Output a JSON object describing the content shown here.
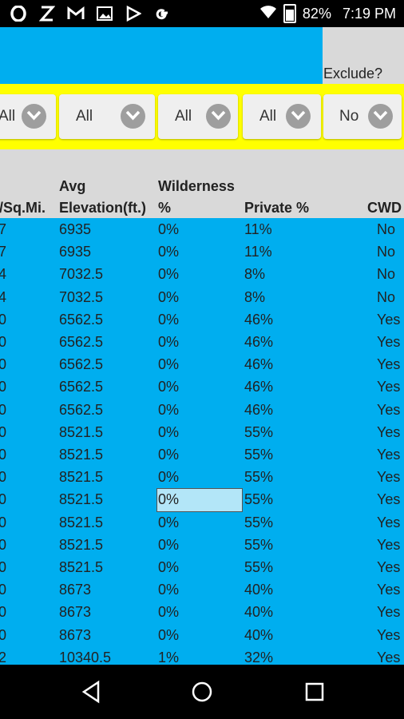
{
  "status_bar": {
    "left_icons": [
      "opera-icon",
      "x-icon",
      "gmail-icon",
      "image-icon",
      "play-store-icon",
      "google-icon"
    ],
    "battery": "82%",
    "time": "7:19 PM"
  },
  "exclude_label": "Exclude?",
  "filters": [
    {
      "label": "All"
    },
    {
      "label": "All"
    },
    {
      "label": "All"
    },
    {
      "label": "All"
    },
    {
      "label": "No"
    }
  ],
  "headers": {
    "col1": "./Sq.Mi.",
    "col2_top": "Avg",
    "col2": "Elevation(ft.)",
    "col3_top": "Wilderness",
    "col3": "%",
    "col4": "Private %",
    "col5": "CWD"
  },
  "rows": [
    {
      "a": "7",
      "b": "6935",
      "c": "0%",
      "d": "11%",
      "e": "No"
    },
    {
      "a": "7",
      "b": "6935",
      "c": "0%",
      "d": "11%",
      "e": "No"
    },
    {
      "a": "4",
      "b": "7032.5",
      "c": "0%",
      "d": "8%",
      "e": "No"
    },
    {
      "a": "4",
      "b": "7032.5",
      "c": "0%",
      "d": "8%",
      "e": "No"
    },
    {
      "a": "0",
      "b": "6562.5",
      "c": "0%",
      "d": "46%",
      "e": "Yes"
    },
    {
      "a": "0",
      "b": "6562.5",
      "c": "0%",
      "d": "46%",
      "e": "Yes"
    },
    {
      "a": "0",
      "b": "6562.5",
      "c": "0%",
      "d": "46%",
      "e": "Yes"
    },
    {
      "a": "0",
      "b": "6562.5",
      "c": "0%",
      "d": "46%",
      "e": "Yes"
    },
    {
      "a": "0",
      "b": "6562.5",
      "c": "0%",
      "d": "46%",
      "e": "Yes"
    },
    {
      "a": "0",
      "b": "8521.5",
      "c": "0%",
      "d": "55%",
      "e": "Yes"
    },
    {
      "a": "0",
      "b": "8521.5",
      "c": "0%",
      "d": "55%",
      "e": "Yes"
    },
    {
      "a": "0",
      "b": "8521.5",
      "c": "0%",
      "d": "55%",
      "e": "Yes"
    },
    {
      "a": "0",
      "b": "8521.5",
      "c": "0%",
      "d": "55%",
      "e": "Yes"
    },
    {
      "a": "0",
      "b": "8521.5",
      "c": "0%",
      "d": "55%",
      "e": "Yes"
    },
    {
      "a": "0",
      "b": "8521.5",
      "c": "0%",
      "d": "55%",
      "e": "Yes"
    },
    {
      "a": "0",
      "b": "8521.5",
      "c": "0%",
      "d": "55%",
      "e": "Yes"
    },
    {
      "a": "0",
      "b": "8673",
      "c": "0%",
      "d": "40%",
      "e": "Yes"
    },
    {
      "a": "0",
      "b": "8673",
      "c": "0%",
      "d": "40%",
      "e": "Yes"
    },
    {
      "a": "0",
      "b": "8673",
      "c": "0%",
      "d": "40%",
      "e": "Yes"
    },
    {
      "a": "2",
      "b": "10340.5",
      "c": "1%",
      "d": "32%",
      "e": "Yes"
    }
  ],
  "colors": {
    "table_bg": "#00aeef",
    "filter_bar": "#ffff00",
    "header_bg": "#d9d9d9"
  },
  "nav_icons": [
    "back-icon",
    "home-icon",
    "recents-icon"
  ]
}
